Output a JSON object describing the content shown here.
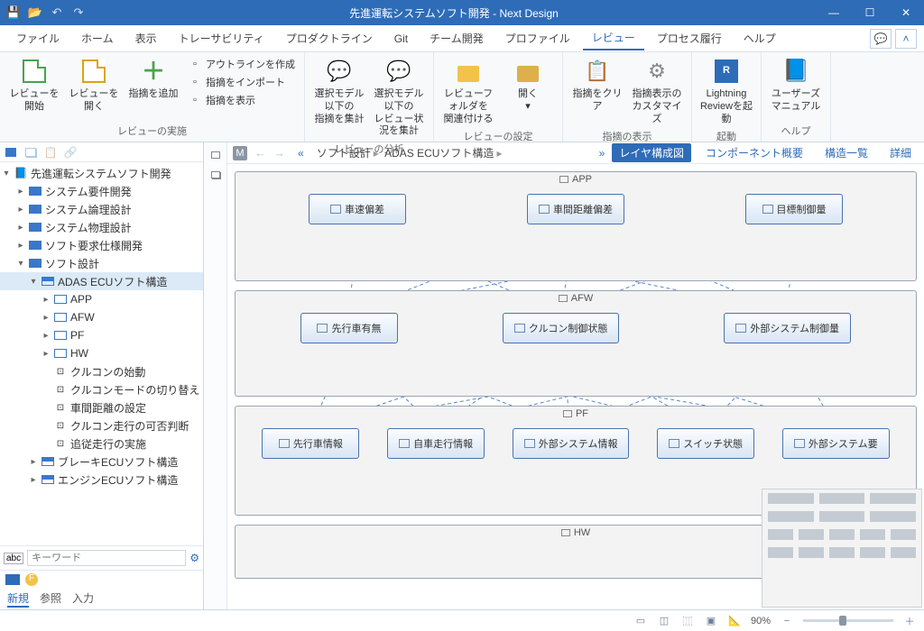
{
  "title": "先進運転システムソフト開発 - Next Design",
  "menus": [
    "ファイル",
    "ホーム",
    "表示",
    "トレーサビリティ",
    "プロダクトライン",
    "Git",
    "チーム開発",
    "プロファイル",
    "レビュー",
    "プロセス履行",
    "ヘルプ"
  ],
  "active_menu": 8,
  "ribbon": {
    "groups": [
      {
        "label": "レビューの実施",
        "big": [
          {
            "name": "start-review",
            "label": "レビューを開始"
          },
          {
            "name": "open-review",
            "label": "レビューを開く"
          },
          {
            "name": "add-finding",
            "label": "指摘を追加"
          }
        ],
        "small": [
          {
            "name": "create-outline",
            "label": "アウトラインを作成"
          },
          {
            "name": "import-findings",
            "label": "指摘をインポート"
          },
          {
            "name": "show-findings",
            "label": "指摘を表示"
          }
        ]
      },
      {
        "label": "レビューの分析",
        "big": [
          {
            "name": "agg-findings-below",
            "label": "選択モデル以下の\n指摘を集計"
          },
          {
            "name": "agg-status-below",
            "label": "選択モデル以下の\nレビュー状況を集計"
          }
        ]
      },
      {
        "label": "レビューの設定",
        "big": [
          {
            "name": "link-review-folder",
            "label": "レビューフォルダを\n関連付ける"
          },
          {
            "name": "open",
            "label": "開く\n▾"
          }
        ]
      },
      {
        "label": "指摘の表示",
        "big": [
          {
            "name": "clear-findings",
            "label": "指摘をクリア"
          },
          {
            "name": "customize-finding-display",
            "label": "指摘表示の\nカスタマイズ"
          }
        ]
      },
      {
        "label": "起動",
        "big": [
          {
            "name": "launch-lightning-review",
            "label": "Lightning\nReviewを起動"
          }
        ]
      },
      {
        "label": "ヘルプ",
        "big": [
          {
            "name": "user-manual",
            "label": "ユーザーズ\nマニュアル"
          }
        ]
      }
    ]
  },
  "tree": {
    "root": "先進運転システムソフト開発",
    "nodes": [
      {
        "ind": 1,
        "tw": "▸",
        "label": "システム要件開発"
      },
      {
        "ind": 1,
        "tw": "▸",
        "label": "システム論理設計"
      },
      {
        "ind": 1,
        "tw": "▸",
        "label": "システム物理設計"
      },
      {
        "ind": 1,
        "tw": "▸",
        "label": "ソフト要求仕様開発"
      },
      {
        "ind": 1,
        "tw": "▾",
        "label": "ソフト設計"
      },
      {
        "ind": 2,
        "tw": "▾",
        "label": "ADAS ECUソフト構造",
        "sel": true,
        "icon": "grid"
      },
      {
        "ind": 3,
        "tw": "▸",
        "label": "APP",
        "icon": "layer"
      },
      {
        "ind": 3,
        "tw": "▸",
        "label": "AFW",
        "icon": "layer"
      },
      {
        "ind": 3,
        "tw": "▸",
        "label": "PF",
        "icon": "layer"
      },
      {
        "ind": 3,
        "tw": "▸",
        "label": "HW",
        "icon": "layer"
      },
      {
        "ind": 3,
        "tw": "",
        "label": "クルコンの始動",
        "icon": "uc"
      },
      {
        "ind": 3,
        "tw": "",
        "label": "クルコンモードの切り替え",
        "icon": "uc"
      },
      {
        "ind": 3,
        "tw": "",
        "label": "車間距離の設定",
        "icon": "uc"
      },
      {
        "ind": 3,
        "tw": "",
        "label": "クルコン走行の可否判断",
        "icon": "uc"
      },
      {
        "ind": 3,
        "tw": "",
        "label": "追従走行の実施",
        "icon": "uc"
      },
      {
        "ind": 2,
        "tw": "▸",
        "label": "ブレーキECUソフト構造",
        "icon": "grid"
      },
      {
        "ind": 2,
        "tw": "▸",
        "label": "エンジンECUソフト構造",
        "icon": "grid"
      }
    ],
    "search_placeholder": "キーワード",
    "tabs": [
      "新規",
      "参照",
      "入力"
    ],
    "active_tab": 0
  },
  "editor": {
    "breadcrumb": [
      "ソフト設計",
      "ADAS ECUソフト構造"
    ],
    "view_buttons": [
      {
        "label": "レイヤ構成図",
        "active": true
      },
      {
        "label": "コンポーネント概要"
      },
      {
        "label": "構造一覧"
      },
      {
        "label": "詳細"
      }
    ],
    "layers": [
      {
        "name": "APP",
        "blocks": [
          "車速偏差",
          "車間距離偏差",
          "目標制御量"
        ]
      },
      {
        "name": "AFW",
        "blocks": [
          "先行車有無",
          "クルコン制御状態",
          "外部システム制御量"
        ]
      },
      {
        "name": "PF",
        "blocks": [
          "先行車情報",
          "自車走行情報",
          "外部システム情報",
          "スイッチ状態",
          "外部システム要"
        ]
      },
      {
        "name": "HW",
        "blocks": []
      }
    ]
  },
  "status": {
    "zoom": "90%"
  }
}
